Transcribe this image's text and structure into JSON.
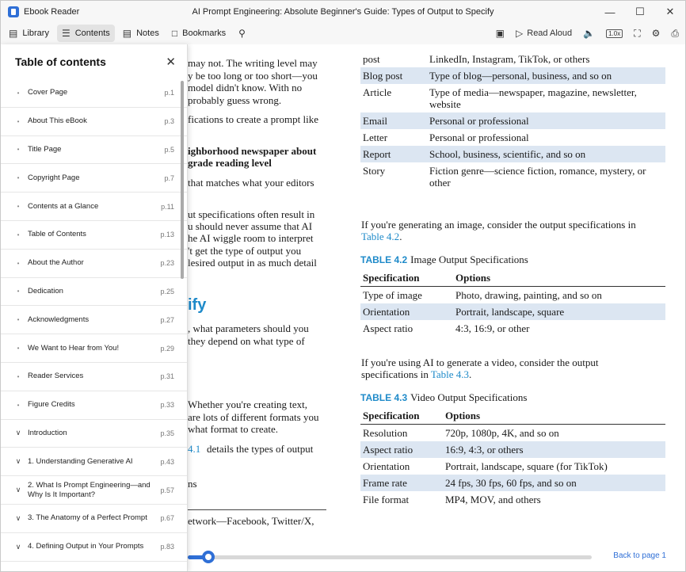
{
  "window": {
    "app_name": "Ebook Reader",
    "title": "AI Prompt Engineering: Absolute Beginner's Guide: Types of Output to Specify"
  },
  "toolbar": {
    "library": "Library",
    "contents": "Contents",
    "notes": "Notes",
    "bookmarks": "Bookmarks",
    "read_aloud": "Read Aloud",
    "speed": "1.0x"
  },
  "sidebar": {
    "title": "Table of contents",
    "items": [
      {
        "label": "Cover Page",
        "page": "p.1",
        "expandable": false
      },
      {
        "label": "About This eBook",
        "page": "p.3",
        "expandable": false
      },
      {
        "label": "Title Page",
        "page": "p.5",
        "expandable": false
      },
      {
        "label": "Copyright Page",
        "page": "p.7",
        "expandable": false
      },
      {
        "label": "Contents at a Glance",
        "page": "p.11",
        "expandable": false
      },
      {
        "label": "Table of Contents",
        "page": "p.13",
        "expandable": false
      },
      {
        "label": "About the Author",
        "page": "p.23",
        "expandable": false
      },
      {
        "label": "Dedication",
        "page": "p.25",
        "expandable": false
      },
      {
        "label": "Acknowledgments",
        "page": "p.27",
        "expandable": false
      },
      {
        "label": "We Want to Hear from You!",
        "page": "p.29",
        "expandable": false
      },
      {
        "label": "Reader Services",
        "page": "p.31",
        "expandable": false
      },
      {
        "label": "Figure Credits",
        "page": "p.33",
        "expandable": false
      },
      {
        "label": "Introduction",
        "page": "p.35",
        "expandable": true
      },
      {
        "label": "1. Understanding Generative AI",
        "page": "p.43",
        "expandable": true
      },
      {
        "label": "2. What Is Prompt Engineering—and Why Is It Important?",
        "page": "p.57",
        "expandable": true
      },
      {
        "label": "3. The Anatomy of a Perfect Prompt",
        "page": "p.67",
        "expandable": true
      },
      {
        "label": "4. Defining Output in Your Prompts",
        "page": "p.83",
        "expandable": true
      }
    ]
  },
  "left_page": {
    "lines": [
      "may not. The writing level may",
      "y be too long or too short—you",
      "model didn't know. With no",
      "probably guess wrong.",
      "fications to create a prompt like",
      "ighborhood newspaper about",
      "grade reading level",
      "that matches what your editors",
      "ut specifications often result in",
      "u should never assume that AI",
      "he AI wiggle room to interpret",
      "'t get the type of output you",
      "lesired output in as much detail",
      "ify",
      ", what parameters should you",
      "they depend on what type of",
      "Whether you're creating text,",
      "are lots of different formats you",
      "what format to create.",
      "4.1",
      "details the types of output",
      "ns",
      "etwork—Facebook, Twitter/X,"
    ]
  },
  "right_page": {
    "top_rows": [
      {
        "type": "post",
        "options": "LinkedIn, Instagram, TikTok, or others",
        "shade": false
      },
      {
        "type": "Blog post",
        "options": "Type of blog—personal, business, and so on",
        "shade": true
      },
      {
        "type": "Article",
        "options": "Type of media—newspaper, magazine, newsletter, website",
        "shade": false
      },
      {
        "type": "Email",
        "options": "Personal or professional",
        "shade": true
      },
      {
        "type": "Letter",
        "options": "Personal or professional",
        "shade": false
      },
      {
        "type": "Report",
        "options": "School, business, scientific, and so on",
        "shade": true
      },
      {
        "type": "Story",
        "options": "Fiction genre—science fiction, romance, mystery, or other",
        "shade": false
      }
    ],
    "para1_a": "If you're generating an image, consider the output specifications in",
    "para1_link": "Table 4.2",
    "para1_end": ".",
    "table2_num": "TABLE 4.2",
    "table2_title": "Image Output Specifications",
    "table2_head": [
      "Specification",
      "Options"
    ],
    "table2_rows": [
      {
        "spec": "Type of image",
        "options": "Photo, drawing, painting, and so on",
        "shade": false
      },
      {
        "spec": "Orientation",
        "options": "Portrait, landscape, square",
        "shade": true
      },
      {
        "spec": "Aspect ratio",
        "options": "4:3, 16:9, or other",
        "shade": false
      }
    ],
    "para2_a": "If you're using AI to generate a video, consider the output",
    "para2_b": "specifications in",
    "para2_link": "Table 4.3",
    "para2_end": ".",
    "table3_num": "TABLE 4.3",
    "table3_title": "Video Output Specifications",
    "table3_head": [
      "Specification",
      "Options"
    ],
    "table3_rows": [
      {
        "spec": "Resolution",
        "options": "720p, 1080p, 4K, and so on",
        "shade": false
      },
      {
        "spec": "Aspect ratio",
        "options": "16:9, 4:3, or others",
        "shade": true
      },
      {
        "spec": "Orientation",
        "options": "Portrait, landscape, square (for TikTok)",
        "shade": false
      },
      {
        "spec": "Frame rate",
        "options": "24 fps, 30 fps, 60 fps, and so on",
        "shade": true
      },
      {
        "spec": "File format",
        "options": "MP4, MOV, and others",
        "shade": false
      }
    ]
  },
  "bottom": {
    "progress": 0.05,
    "back_link": "Back to page 1"
  },
  "colors": {
    "accent": "#2f6fd6",
    "heading": "#1e8ac9",
    "table_shade": "#dce6f2"
  }
}
